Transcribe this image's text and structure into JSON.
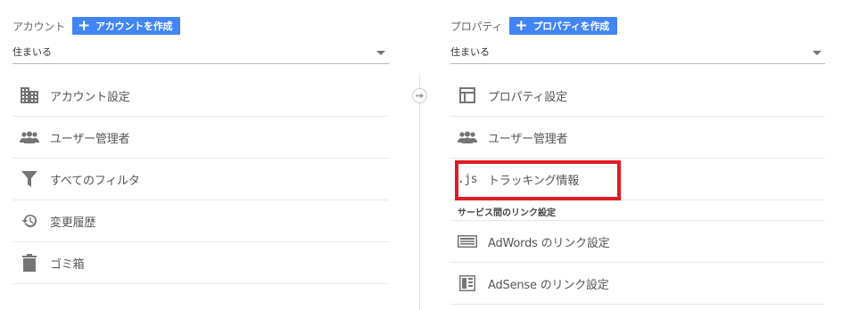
{
  "account": {
    "header_label": "アカウント",
    "create_button": "アカウントを作成",
    "selected": "住まいる",
    "menu": [
      {
        "label": "アカウント設定",
        "icon": "building-icon"
      },
      {
        "label": "ユーザー管理者",
        "icon": "users-icon"
      },
      {
        "label": "すべてのフィルタ",
        "icon": "filter-icon"
      },
      {
        "label": "変更履歴",
        "icon": "history-icon"
      },
      {
        "label": "ゴミ箱",
        "icon": "trash-icon"
      }
    ]
  },
  "property": {
    "header_label": "プロパティ",
    "create_button": "プロパティを作成",
    "selected": "住まいる",
    "menu": [
      {
        "label": "プロパティ設定",
        "icon": "layout-icon"
      },
      {
        "label": "ユーザー管理者",
        "icon": "users-icon"
      },
      {
        "label": "トラッキング情報",
        "icon": "js-icon",
        "icon_text": ".js"
      }
    ],
    "section_title": "サービス間のリンク設定",
    "link_menu": [
      {
        "label": "AdWords のリンク設定",
        "icon": "adwords-icon"
      },
      {
        "label": "AdSense のリンク設定",
        "icon": "adsense-icon"
      }
    ]
  },
  "colors": {
    "accent": "#4285f4",
    "highlight": "#e01b24"
  }
}
